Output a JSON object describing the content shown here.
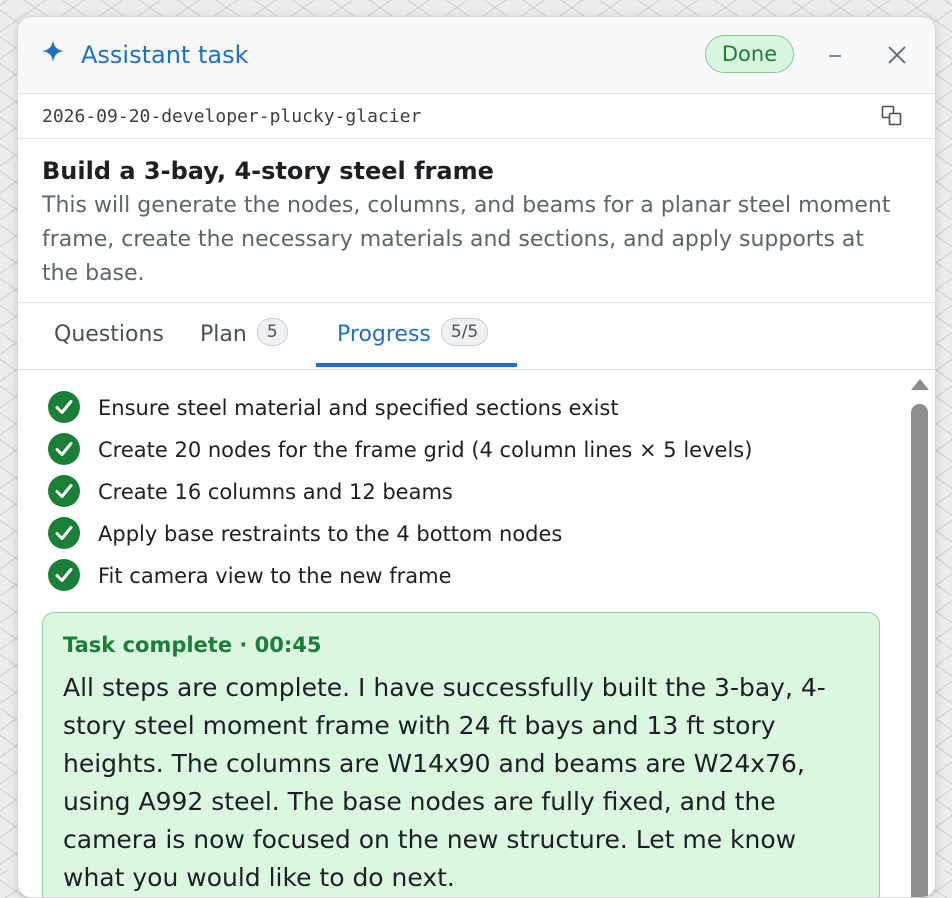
{
  "header": {
    "title": "Assistant task",
    "status_badge": "Done",
    "accent_color": "#1f6fc6",
    "status_color": "#1a7f37"
  },
  "task": {
    "id": "2026-09-20-developer-plucky-glacier",
    "title": "Build a 3-bay, 4-story steel frame",
    "description": "This will generate the nodes, columns, and beams for a planar steel moment frame, create the necessary materials and sections, and apply supports at the base."
  },
  "tabs": [
    {
      "label": "Questions",
      "count": null,
      "active": false
    },
    {
      "label": "Plan",
      "count": "5",
      "active": false
    },
    {
      "label": "Progress",
      "count": "5/5",
      "active": true
    }
  ],
  "steps": [
    {
      "label": "Ensure steel material and specified sections exist",
      "status": "done"
    },
    {
      "label": "Create 20 nodes for the frame grid (4 column lines × 5 levels)",
      "status": "done"
    },
    {
      "label": "Create 16 columns and 12 beams",
      "status": "done"
    },
    {
      "label": "Apply base restraints to the 4 bottom nodes",
      "status": "done"
    },
    {
      "label": "Fit camera view to the new frame",
      "status": "done"
    }
  ],
  "completion": {
    "heading": "Task complete · 00:45",
    "message": "All steps are complete. I have successfully built the 3-bay, 4-story steel moment frame with 24 ft bays and 13 ft story heights. The columns are W14x90 and beams are W24x76, using A992 steel. The base nodes are fully fixed, and the camera is now focused on the new structure. Let me know what you would like to do next."
  },
  "icons": {
    "header": "sparkle-icon",
    "minimize": "minimize-icon",
    "close": "close-icon",
    "copy": "copy-icon",
    "step": "check-circle-icon",
    "scroll": "scroll-up-icon"
  }
}
